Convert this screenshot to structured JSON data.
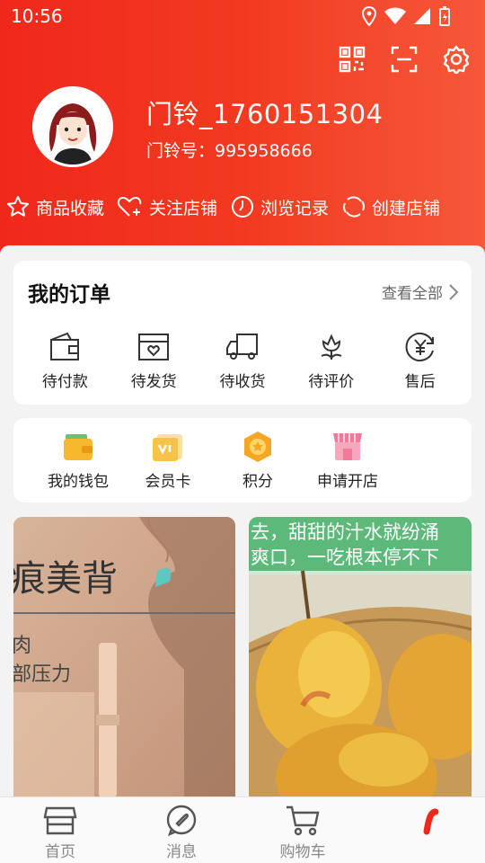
{
  "status_bar": {
    "time": "10:56"
  },
  "user": {
    "name": "门铃_1760151304",
    "id_label": "门铃号：995958666"
  },
  "quick_links": [
    {
      "label": "商品收藏",
      "icon": "star-icon"
    },
    {
      "label": "关注店铺",
      "icon": "heart-plus-icon"
    },
    {
      "label": "浏览记录",
      "icon": "clock-icon"
    },
    {
      "label": "创建店铺",
      "icon": "refresh-icon"
    }
  ],
  "orders": {
    "title": "我的订单",
    "view_all": "查看全部",
    "items": [
      {
        "label": "待付款",
        "icon": "wallet-icon"
      },
      {
        "label": "待发货",
        "icon": "box-icon"
      },
      {
        "label": "待收货",
        "icon": "truck-icon"
      },
      {
        "label": "待评价",
        "icon": "flower-icon"
      },
      {
        "label": "售后",
        "icon": "yen-refund-icon"
      }
    ]
  },
  "tools": [
    {
      "label": "我的钱包",
      "icon": "wallet-color-icon",
      "color": "#f5b82e"
    },
    {
      "label": "会员卡",
      "icon": "vip-card-icon",
      "color": "#f6c24a"
    },
    {
      "label": "积分",
      "icon": "points-icon",
      "color": "#f5a623"
    },
    {
      "label": "申请开店",
      "icon": "shop-icon",
      "color": "#f2799a"
    }
  ],
  "products": {
    "left_text_1": "痕美背",
    "left_text_2": "肉",
    "left_text_3": "部压力",
    "right_text_1": "去，甜甜的汁水就纷涌",
    "right_text_2": "爽口，一吃根本停不下"
  },
  "bottom_nav": [
    {
      "label": "首页",
      "icon": "shop-front-icon"
    },
    {
      "label": "消息",
      "icon": "message-icon"
    },
    {
      "label": "购物车",
      "icon": "cart-icon"
    }
  ],
  "colors": {
    "primary": "#f0281b",
    "card_bg": "#ffffff",
    "page_bg": "#f3f3f3"
  }
}
